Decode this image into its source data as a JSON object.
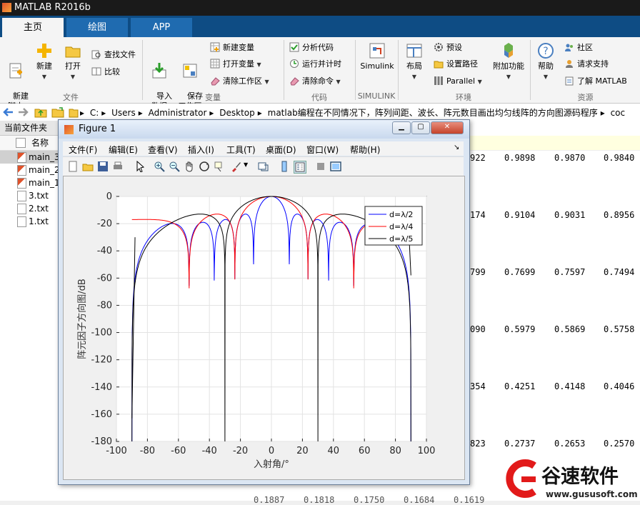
{
  "app": {
    "title": "MATLAB R2016b",
    "tabs": [
      "主页",
      "绘图",
      "APP"
    ]
  },
  "ribbon": {
    "file_group": {
      "label": "文件",
      "new_script": "新建\n脚本",
      "new": "新建",
      "open": "打开",
      "find_files": "查找文件",
      "compare": "比较"
    },
    "variable_group": {
      "label": "变量",
      "import_data": "导入\n数据",
      "save_workspace": "保存\n工作区",
      "new_variable": "新建变量",
      "open_variable": "打开变量",
      "clear_workspace": "清除工作区"
    },
    "code_group": {
      "label": "代码",
      "analyze_code": "分析代码",
      "run_and_time": "运行并计时",
      "clear_commands": "清除命令"
    },
    "simulink_group": {
      "label": "SIMULINK",
      "simulink": "Simulink"
    },
    "environment_group": {
      "label": "环境",
      "layout": "布局",
      "preferences": "预设",
      "set_path": "设置路径",
      "parallel": "Parallel",
      "add_ons": "附加功能"
    },
    "resources_group": {
      "label": "资源",
      "help": "帮助",
      "community": "社区",
      "request_support": "请求支持",
      "learn_matlab": "了解 MATLAB"
    }
  },
  "address": {
    "crumbs": [
      "C:",
      "Users",
      "Administrator",
      "Desktop",
      "matlab编程在不同情况下，阵列间距、波长、阵元数目画出均匀线阵的方向图源码程序",
      "coc"
    ]
  },
  "file_panel": {
    "title": "当前文件夹",
    "column_name": "名称",
    "files": [
      "main_3",
      "main_2",
      "main_1",
      "3.txt",
      "2.txt",
      "1.txt"
    ]
  },
  "command_window": {
    "rows": [
      [
        "922",
        "0.9898",
        "0.9870",
        "0.9840"
      ],
      [
        "174",
        "0.9104",
        "0.9031",
        "0.8956"
      ],
      [
        "799",
        "0.7699",
        "0.7597",
        "0.7494"
      ],
      [
        "090",
        "0.5979",
        "0.5869",
        "0.5758"
      ],
      [
        "354",
        "0.4251",
        "0.4148",
        "0.4046"
      ],
      [
        "823",
        "0.2737",
        "0.2653",
        "0.2570"
      ]
    ],
    "bottom_row": [
      "0.1887",
      "0.1818",
      "0.1750",
      "0.1684",
      "0.1619"
    ]
  },
  "figure": {
    "title": "Figure 1",
    "menus": [
      "文件(F)",
      "编辑(E)",
      "查看(V)",
      "插入(I)",
      "工具(T)",
      "桌面(D)",
      "窗口(W)",
      "帮助(H)"
    ]
  },
  "chart_data": {
    "type": "line",
    "title": "",
    "xlabel": "入射角/°",
    "ylabel": "阵元因子方向图/dB",
    "xlim": [
      -100,
      100
    ],
    "ylim": [
      -180,
      0
    ],
    "xticks": [
      -100,
      -80,
      -60,
      -40,
      -20,
      0,
      20,
      40,
      60,
      80,
      100
    ],
    "yticks": [
      0,
      -20,
      -40,
      -60,
      -80,
      -100,
      -120,
      -140,
      -160,
      -180
    ],
    "grid": true,
    "legend_position": "top-right",
    "series": [
      {
        "name": "d=λ/2",
        "color": "#0000ff",
        "d_over_lambda": 0.5
      },
      {
        "name": "d=λ/4",
        "color": "#ff0000",
        "d_over_lambda": 0.25
      },
      {
        "name": "d=λ/5",
        "color": "#000000",
        "d_over_lambda": 0.2
      }
    ],
    "notable_points": [
      {
        "x": -90,
        "y": -163
      },
      {
        "x": 90,
        "y": -58
      },
      {
        "x": 0,
        "y": 0
      }
    ]
  },
  "watermark": {
    "name": "谷速软件",
    "url": "www.gususoft.com"
  }
}
